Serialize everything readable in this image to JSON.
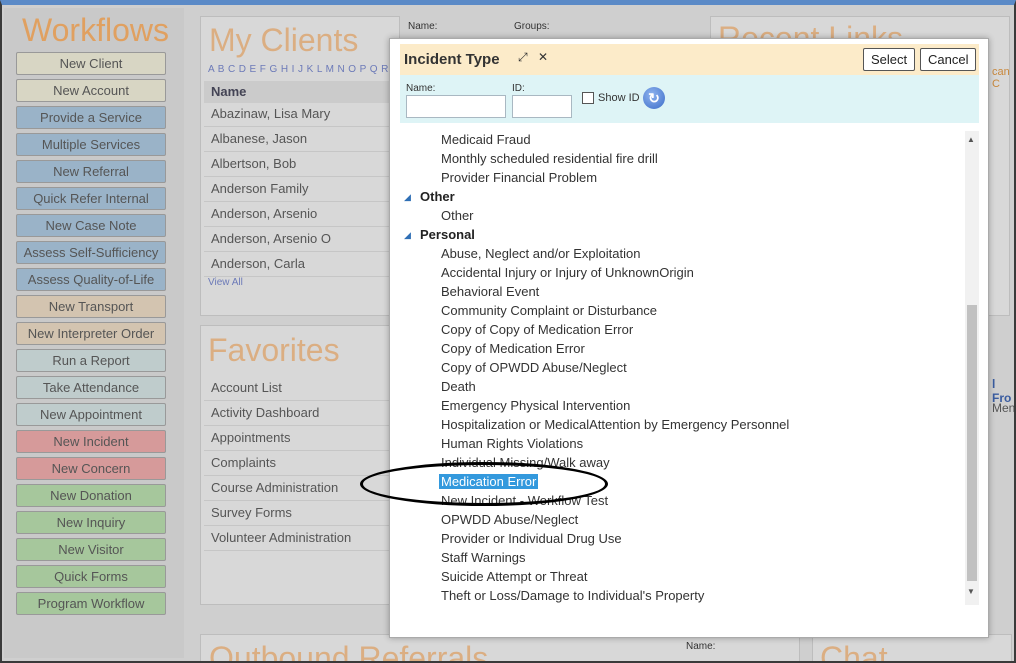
{
  "workflows": {
    "title": "Workflows",
    "buttons": [
      {
        "label": "New Client",
        "color": "#d8d6c4"
      },
      {
        "label": "New Account",
        "color": "#d8d6c4"
      },
      {
        "label": "Provide a Service",
        "color": "#9ab3c8"
      },
      {
        "label": "Multiple Services",
        "color": "#9ab3c8"
      },
      {
        "label": "New Referral",
        "color": "#9ab3c8"
      },
      {
        "label": "Quick Refer Internal",
        "color": "#9ab3c8"
      },
      {
        "label": "New Case Note",
        "color": "#9ab3c8"
      },
      {
        "label": "Assess Self-Sufficiency",
        "color": "#9ab3c8"
      },
      {
        "label": "Assess Quality-of-Life",
        "color": "#9ab3c8"
      },
      {
        "label": "New Transport",
        "color": "#d3c4b0"
      },
      {
        "label": "New Interpreter Order",
        "color": "#d3c4b0"
      },
      {
        "label": "Run a Report",
        "color": "#bfcccc"
      },
      {
        "label": "Take Attendance",
        "color": "#bfcccc"
      },
      {
        "label": "New Appointment",
        "color": "#bfcccc"
      },
      {
        "label": "New Incident",
        "color": "#d69a9a"
      },
      {
        "label": "New Concern",
        "color": "#d69a9a"
      },
      {
        "label": "New Donation",
        "color": "#a6c79c"
      },
      {
        "label": "New Inquiry",
        "color": "#a6c79c"
      },
      {
        "label": "New Visitor",
        "color": "#a6c79c"
      },
      {
        "label": "Quick Forms",
        "color": "#a6c79c"
      },
      {
        "label": "Program Workflow",
        "color": "#a6c79c"
      }
    ]
  },
  "my_clients": {
    "title": "My Clients",
    "alphabet": "A B C D E F G H I J K L M N O P Q R S",
    "column": "Name",
    "name_label": "Name:",
    "groups_label": "Groups:",
    "rows": [
      "Abazinaw, Lisa Mary",
      "Albanese, Jason",
      "Albertson, Bob",
      "Anderson Family",
      "Anderson, Arsenio",
      "Anderson, Arsenio O",
      "Anderson, Carla"
    ],
    "view_all": "View All"
  },
  "favorites": {
    "title": "Favorites",
    "items": [
      "Account List",
      "Activity Dashboard",
      "Appointments",
      "Complaints",
      "Course Administration",
      "Survey Forms",
      "Volunteer Administration"
    ]
  },
  "recent_links": {
    "title": "Recent Links"
  },
  "outbound_referrals": {
    "title": "Outbound Referrals",
    "name_label": "Name:"
  },
  "chat": {
    "title": "Chat"
  },
  "right_fragments": {
    "top": "can C",
    "middle": "l Fro",
    "lower": "Men"
  },
  "modal": {
    "title": "Incident Type",
    "select_label": "Select",
    "cancel_label": "Cancel",
    "name_label": "Name:",
    "id_label": "ID:",
    "show_id_label": "Show ID",
    "top_items": [
      "Medicaid Fraud",
      "Monthly scheduled residential fire drill",
      "Provider Financial Problem"
    ],
    "groups": [
      {
        "name": "Other",
        "items": [
          "Other"
        ]
      },
      {
        "name": "Personal",
        "items": [
          "Abuse, Neglect and/or Exploitation",
          "Accidental Injury or Injury of UnknownOrigin",
          "Behavioral Event",
          "Community Complaint or Disturbance",
          "Copy of Copy of Medication Error",
          "Copy of Medication Error",
          "Copy of OPWDD Abuse/Neglect",
          "Death",
          "Emergency Physical Intervention",
          "Hospitalization or MedicalAttention by Emergency Personnel",
          "Human Rights Violations",
          "Individual Missing/Walk away",
          "Medication Error",
          "New Incident - Workflow Test",
          "OPWDD Abuse/Neglect",
          "Provider or Individual Drug Use",
          "Staff Warnings",
          "Suicide Attempt or Threat",
          "Theft or Loss/Damage to Individual's Property"
        ]
      }
    ],
    "selected_item": "Medication Error"
  }
}
